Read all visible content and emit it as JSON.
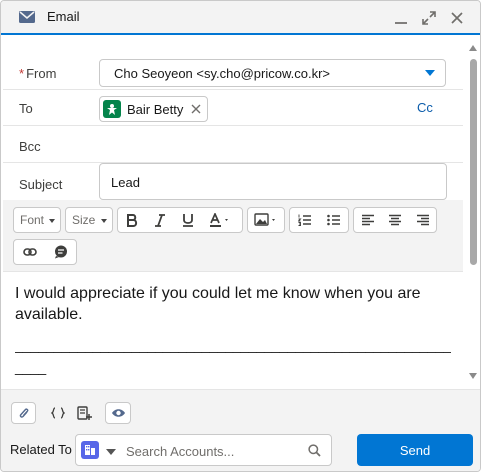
{
  "window": {
    "title": "Email"
  },
  "from": {
    "label": "From",
    "required_mark": "*",
    "value": "Cho Seoyeon <sy.cho@pricow.co.kr>"
  },
  "to": {
    "label": "To",
    "recipient": "Bair Betty",
    "cc_label": "Cc"
  },
  "bcc": {
    "label": "Bcc"
  },
  "subject": {
    "label": "Subject",
    "value": "Lead"
  },
  "toolbar": {
    "font_label": "Font",
    "size_label": "Size"
  },
  "body": {
    "text": "I would appreciate if you could let me know when you are available.",
    "signature_line": "________________________________________________________",
    "signature_line_2": "____"
  },
  "footer": {
    "related_label": "Related To",
    "search_placeholder": "Search Accounts...",
    "send_label": "Send"
  },
  "colors": {
    "brand": "#0176d3",
    "contact": "#04844b",
    "account": "#5867e8"
  }
}
